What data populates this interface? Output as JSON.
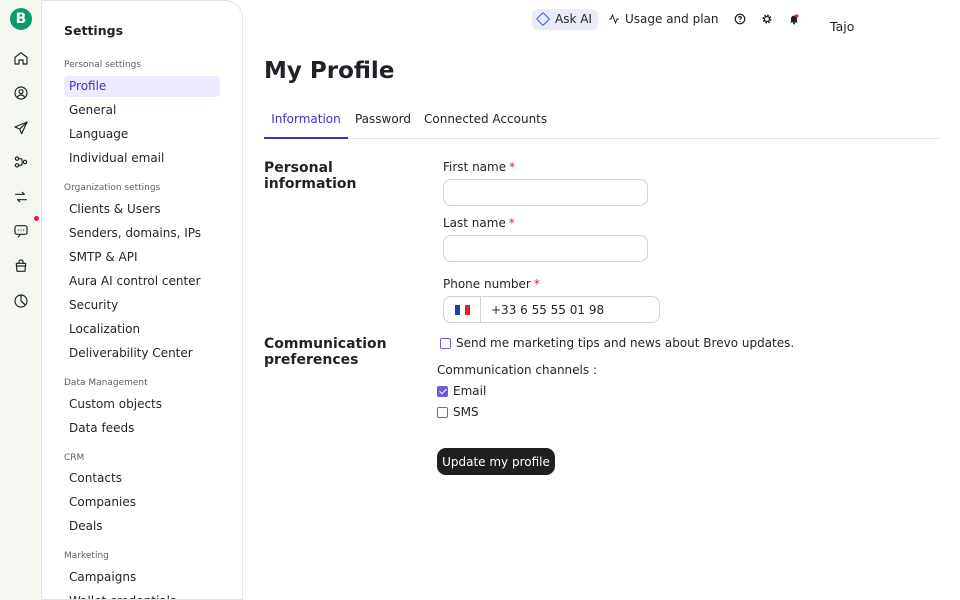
{
  "app": {
    "logo_letter": "B",
    "brand_color": "#0b996e",
    "accent_color": "#3b34c2"
  },
  "rail": {
    "icons": [
      "home-icon",
      "user-circle-icon",
      "send-icon",
      "automation-icon",
      "sync-icon",
      "chat-icon",
      "shopping-bag-icon",
      "pie-chart-icon"
    ]
  },
  "sidebar": {
    "title": "Settings",
    "sections": [
      {
        "label": "Personal settings",
        "items": [
          "Profile",
          "General",
          "Language",
          "Individual email"
        ]
      },
      {
        "label": "Organization settings",
        "items": [
          "Clients & Users",
          "Senders, domains, IPs",
          "SMTP & API",
          "Aura AI control center",
          "Security",
          "Localization",
          "Deliverability Center"
        ]
      },
      {
        "label": "Data Management",
        "items": [
          "Custom objects",
          "Data feeds"
        ]
      },
      {
        "label": "CRM",
        "items": [
          "Contacts",
          "Companies",
          "Deals"
        ]
      },
      {
        "label": "Marketing",
        "items": [
          "Campaigns",
          "Wallet credentials"
        ]
      }
    ],
    "active_item": "Profile"
  },
  "topbar": {
    "ask_ai": "Ask AI",
    "usage": "Usage and plan",
    "user_name": "Tajo"
  },
  "main": {
    "title": "My Profile",
    "tabs": [
      "Information",
      "Password",
      "Connected Accounts"
    ],
    "active_tab": "Information",
    "personal_info": {
      "title": "Personal information",
      "first_name_label": "First name",
      "last_name_label": "Last name",
      "phone_label": "Phone number",
      "required_mark": "*",
      "first_name_value": "",
      "last_name_value": "",
      "phone_value": "+33 6 55 55 01 98",
      "phone_country": "FR"
    },
    "communication": {
      "title": "Communication preferences",
      "marketing_optin_label": "Send me marketing tips and news about Brevo updates.",
      "marketing_optin_checked": false,
      "channels_label": "Communication channels :",
      "channel_email_label": "Email",
      "channel_email_checked": true,
      "channel_sms_label": "SMS",
      "channel_sms_checked": false
    },
    "update_button": "Update my profile"
  }
}
